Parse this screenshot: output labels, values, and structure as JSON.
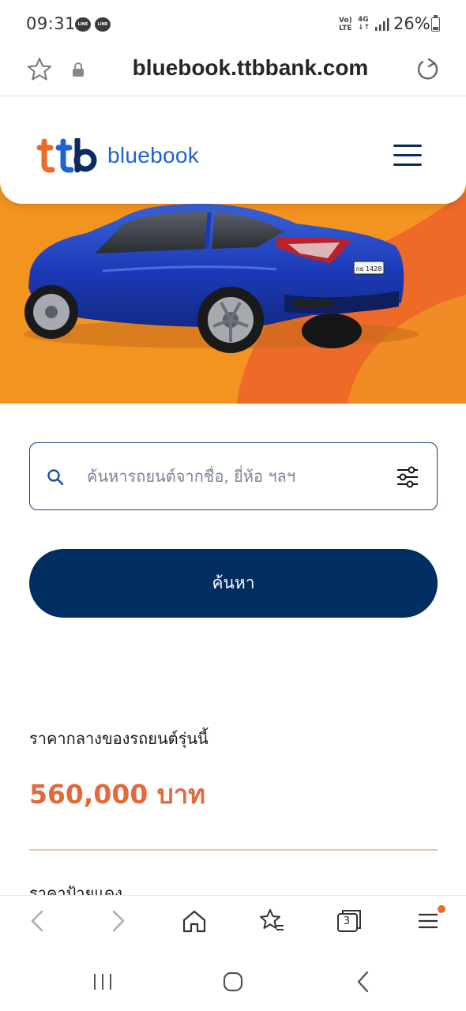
{
  "status_bar": {
    "time": "09:31",
    "notification_icons": [
      "line-icon",
      "line-icon"
    ],
    "notification_text": "LINE",
    "volte_top": "Vo)",
    "volte_bottom": "LTE",
    "network": "4G",
    "battery": "26%"
  },
  "browser": {
    "url": "bluebook.ttbbank.com",
    "tabs_count": "3",
    "has_notification": true
  },
  "site": {
    "logo_mark": "ttb",
    "logo_word": "bluebook",
    "menu_icon": "hamburger-icon",
    "hero_plate": "กธ 1428",
    "brand_colors": {
      "navy": "#002d62",
      "orange": "#f49420",
      "accent_orange": "#e3683a",
      "blue": "#1e62d6"
    }
  },
  "search": {
    "placeholder": "ค้นหารถยนต์จากชื่อ, ยี่ห้อ ฯลฯ",
    "button_label": "ค้นหา"
  },
  "price": {
    "label": "ราคากลางของรถยนต์รุ่นนี้",
    "value": "560,000 บาท",
    "next_label": "ราคาป้ายแดง"
  }
}
